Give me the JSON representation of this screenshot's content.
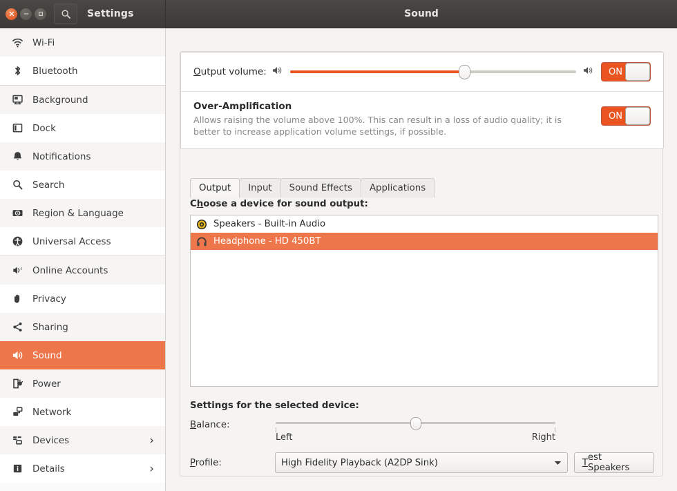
{
  "window": {
    "app_title": "Settings",
    "window_title": "Sound",
    "search_icon": "search-icon",
    "close_icon": "close-icon",
    "minimize_icon": "minimize-icon",
    "maximize_icon": "maximize-icon"
  },
  "sidebar": {
    "items": [
      {
        "label": "Wi-Fi",
        "icon": "wifi-icon",
        "selected": false,
        "chevron": ""
      },
      {
        "label": "Bluetooth",
        "icon": "bluetooth-icon",
        "selected": false,
        "chevron": ""
      },
      {
        "label": "Background",
        "icon": "background-icon",
        "selected": false,
        "chevron": ""
      },
      {
        "label": "Dock",
        "icon": "dock-icon",
        "selected": false,
        "chevron": ""
      },
      {
        "label": "Notifications",
        "icon": "bell-icon",
        "selected": false,
        "chevron": ""
      },
      {
        "label": "Search",
        "icon": "search-icon",
        "selected": false,
        "chevron": ""
      },
      {
        "label": "Region & Language",
        "icon": "region-language-icon",
        "selected": false,
        "chevron": ""
      },
      {
        "label": "Universal Access",
        "icon": "accessibility-icon",
        "selected": false,
        "chevron": ""
      },
      {
        "label": "Online Accounts",
        "icon": "online-accounts-icon",
        "selected": false,
        "chevron": ""
      },
      {
        "label": "Privacy",
        "icon": "hand-icon",
        "selected": false,
        "chevron": ""
      },
      {
        "label": "Sharing",
        "icon": "share-icon",
        "selected": false,
        "chevron": ""
      },
      {
        "label": "Sound",
        "icon": "speaker-icon",
        "selected": true,
        "chevron": ""
      },
      {
        "label": "Power",
        "icon": "power-plug-icon",
        "selected": false,
        "chevron": ""
      },
      {
        "label": "Network",
        "icon": "network-icon",
        "selected": false,
        "chevron": ""
      },
      {
        "label": "Devices",
        "icon": "devices-icon",
        "selected": false,
        "chevron": "›"
      },
      {
        "label": "Details",
        "icon": "info-icon",
        "selected": false,
        "chevron": "›"
      }
    ]
  },
  "sound": {
    "output_volume": {
      "label_mnemonic": "O",
      "label_rest": "utput volume:",
      "value_percent": 61,
      "low_icon": "volume-low-icon",
      "high_icon": "volume-high-icon",
      "toggle_state": "ON"
    },
    "over_amplification": {
      "title": "Over-Amplification",
      "description": "Allows raising the volume above 100%. This can result in a loss of audio quality; it is better to increase application volume settings, if possible.",
      "toggle_state": "ON"
    },
    "tabs": [
      {
        "label": "Output",
        "active": true
      },
      {
        "label": "Input",
        "active": false
      },
      {
        "label": "Sound Effects",
        "active": false
      },
      {
        "label": "Applications",
        "active": false
      }
    ],
    "device_section": {
      "label_pre": "C",
      "label_mnemonic": "h",
      "label_rest": "oose a device for sound output:",
      "devices": [
        {
          "name": "Speakers - Built-in Audio",
          "icon": "speaker-device-icon",
          "selected": false
        },
        {
          "name": "Headphone - HD 450BT",
          "icon": "headphone-device-icon",
          "selected": true
        }
      ]
    },
    "settings_section": {
      "heading": "Settings for the selected device:",
      "balance": {
        "label_mnemonic": "B",
        "label_rest": "alance:",
        "left_label": "Left",
        "right_label": "Right",
        "value_percent": 50
      },
      "profile": {
        "label_mnemonic": "P",
        "label_rest": "rofile:",
        "selected_option": "High Fidelity Playback (A2DP Sink)",
        "dropdown_icon": "chevron-down-icon"
      },
      "test_button": {
        "label_mnemonic": "T",
        "label_rest": "est Speakers"
      }
    }
  },
  "colors": {
    "accent": "#e95420",
    "selection": "#ed764a",
    "titlebar": "#3c3937",
    "sidebar_bg": "#fafafa"
  }
}
